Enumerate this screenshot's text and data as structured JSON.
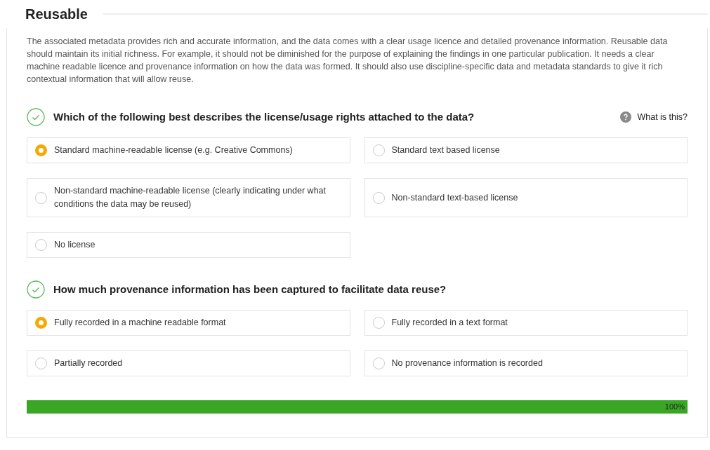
{
  "section": {
    "title": "Reusable",
    "description": "The associated metadata provides rich and accurate information, and the data comes with a clear usage licence and detailed provenance information. Reusable data should maintain its initial richness. For example, it should not be diminished for the purpose of explaining the findings in one particular publication. It needs a clear machine readable licence and provenance information on how the data was formed. It should also use discipline-specific data and metadata standards to give it rich contextual information that will allow reuse."
  },
  "questions": [
    {
      "text": "Which of the following best describes the license/usage rights attached to the data?",
      "answered": true,
      "help": "What is this?",
      "options": [
        {
          "label": "Standard machine-readable license (e.g. Creative Commons)",
          "selected": true
        },
        {
          "label": "Standard text based license",
          "selected": false
        },
        {
          "label": "Non-standard machine-readable license (clearly indicating under what conditions the data may be reused)",
          "selected": false
        },
        {
          "label": "Non-standard text-based license",
          "selected": false
        },
        {
          "label": "No license",
          "selected": false
        }
      ]
    },
    {
      "text": "How much provenance information has been captured to facilitate data reuse?",
      "answered": true,
      "options": [
        {
          "label": "Fully recorded in a machine readable format",
          "selected": true
        },
        {
          "label": "Fully recorded in a text format",
          "selected": false
        },
        {
          "label": "Partially recorded",
          "selected": false
        },
        {
          "label": "No provenance information is recorded",
          "selected": false
        }
      ]
    }
  ],
  "progress": {
    "level": 1,
    "reading": "100%"
  }
}
